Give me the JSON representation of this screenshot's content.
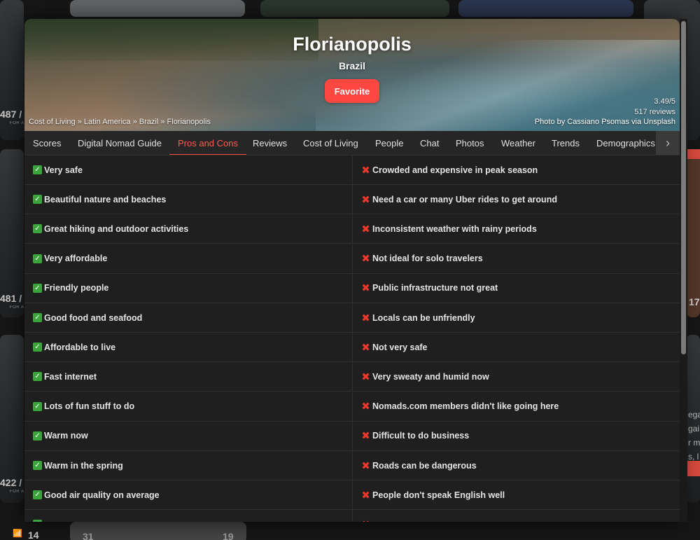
{
  "hero": {
    "city": "Florianopolis",
    "country": "Brazil",
    "favorite_label": "Favorite",
    "breadcrumb": [
      "Cost of Living",
      "Latin America",
      "Brazil",
      "Florianopolis"
    ],
    "breadcrumb_sep": " » ",
    "rating": "3.49/5",
    "reviews": "517 reviews",
    "photo_credit_prefix": "Photo by ",
    "photographer": "Cassiano Psomas",
    "photo_credit_mid": " via ",
    "photo_source": "Unsplash"
  },
  "tabs": [
    {
      "label": "Scores"
    },
    {
      "label": "Digital Nomad Guide"
    },
    {
      "label": "Pros and Cons",
      "active": true
    },
    {
      "label": "Reviews"
    },
    {
      "label": "Cost of Living"
    },
    {
      "label": "People"
    },
    {
      "label": "Chat"
    },
    {
      "label": "Photos"
    },
    {
      "label": "Weather"
    },
    {
      "label": "Trends"
    },
    {
      "label": "Demographics"
    }
  ],
  "pros": [
    "Very safe",
    "Beautiful nature and beaches",
    "Great hiking and outdoor activities",
    "Very affordable",
    "Friendly people",
    "Good food and seafood",
    "Affordable to live",
    "Fast internet",
    "Lots of fun stuff to do",
    "Warm now",
    "Warm in the spring",
    "Good air quality on average"
  ],
  "cons": [
    "Crowded and expensive in peak season",
    "Need a car or many Uber rides to get around",
    "Inconsistent weather with rainy periods",
    "Not ideal for solo travelers",
    "Public infrastructure not great",
    "Locals can be unfriendly",
    "Not very safe",
    "Very sweaty and humid now",
    "Nomads.com members didn't like going here",
    "Difficult to do business",
    "Roads can be dangerous",
    "People don't speak English well"
  ],
  "background": {
    "left_numbers": [
      "487 /",
      "481 /",
      "422 /",
      "14"
    ],
    "right_numbers": [
      "17"
    ],
    "bottom_numbers": [
      "31",
      "19"
    ],
    "right_side_text": [
      "ega",
      "gai",
      "r m",
      "s, l"
    ]
  },
  "colors": {
    "accent": "#ff4742",
    "check": "#3ba53b",
    "cross": "#e8392f"
  }
}
